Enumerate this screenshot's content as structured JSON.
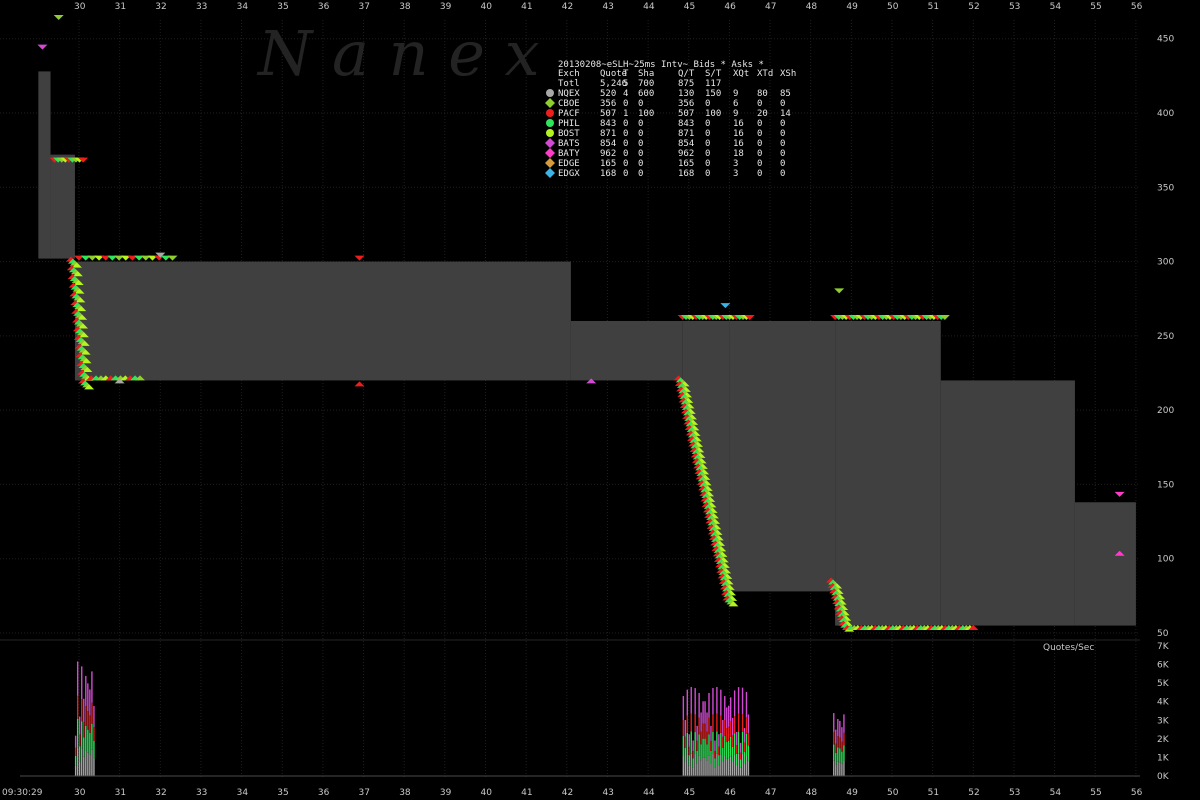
{
  "watermark": "N a n e x",
  "start_time": "09:30:29",
  "quotes_label": "Quotes/Sec",
  "colors": {
    "background": "#000000",
    "spread": "#404040",
    "NQEX": "#a8a8a8",
    "CBOE": "#8ecf2f",
    "PACF": "#ee1e1e",
    "PHIL": "#2ee65a",
    "BOST": "#b4f51e",
    "BATS": "#d24ad2",
    "BATY": "#ff3cc8",
    "EDGE": "#d79b3c",
    "EDGX": "#3cb4e6"
  },
  "table": {
    "title": "20130208~eSLH~25ms Intv~ Bids * Asks *",
    "headers": [
      "Exch",
      "Quote",
      "T",
      "Sha",
      "Q/T",
      "S/T",
      "XQt",
      "XTd",
      "XSh"
    ],
    "total": [
      "Totl",
      "5,246",
      "5",
      "700",
      "875",
      "117",
      "",
      "",
      ""
    ],
    "rows": [
      {
        "exch": "NQEX",
        "marker": "circle",
        "vals": [
          "520",
          "4",
          "600",
          "130",
          "150",
          "9",
          "80",
          "85"
        ]
      },
      {
        "exch": "CBOE",
        "marker": "diamond",
        "vals": [
          "356",
          "0",
          "0",
          "356",
          "0",
          "6",
          "0",
          "0"
        ]
      },
      {
        "exch": "PACF",
        "marker": "circle",
        "vals": [
          "507",
          "1",
          "100",
          "507",
          "100",
          "9",
          "20",
          "14"
        ]
      },
      {
        "exch": "PHIL",
        "marker": "circle",
        "vals": [
          "843",
          "0",
          "0",
          "843",
          "0",
          "16",
          "0",
          "0"
        ]
      },
      {
        "exch": "BOST",
        "marker": "circle",
        "vals": [
          "871",
          "0",
          "0",
          "871",
          "0",
          "16",
          "0",
          "0"
        ]
      },
      {
        "exch": "BATS",
        "marker": "diamond",
        "vals": [
          "854",
          "0",
          "0",
          "854",
          "0",
          "16",
          "0",
          "0"
        ]
      },
      {
        "exch": "BATY",
        "marker": "diamond",
        "vals": [
          "962",
          "0",
          "0",
          "962",
          "0",
          "18",
          "0",
          "0"
        ]
      },
      {
        "exch": "EDGE",
        "marker": "diamond",
        "vals": [
          "165",
          "0",
          "0",
          "165",
          "0",
          "3",
          "0",
          "0"
        ]
      },
      {
        "exch": "EDGX",
        "marker": "diamond",
        "vals": [
          "168",
          "0",
          "0",
          "168",
          "0",
          "3",
          "0",
          "0"
        ]
      }
    ]
  },
  "chart_data": [
    {
      "type": "area",
      "title": "",
      "xlabel": "",
      "ylabel": "",
      "x_unit": "seconds after 09:30",
      "xlim": [
        28.8,
        56.5
      ],
      "ylim": [
        50,
        460
      ],
      "x_ticks": [
        "30",
        "31",
        "32",
        "33",
        "34",
        "35",
        "36",
        "37",
        "38",
        "39",
        "40",
        "41",
        "42",
        "43",
        "44",
        "45",
        "46",
        "47",
        "48",
        "49",
        "50",
        "51",
        "52",
        "53",
        "54",
        "55",
        "56"
      ],
      "y_ticks": [
        50,
        100,
        150,
        200,
        250,
        300,
        350,
        400,
        450
      ],
      "grid": true,
      "spread_bands": [
        {
          "x": [
            29.0,
            29.3
          ],
          "low": 302,
          "high": 428
        },
        {
          "x": [
            29.3,
            29.9
          ],
          "low": 302,
          "high": 372
        },
        {
          "x": [
            29.9,
            42.1
          ],
          "low": 220,
          "high": 300
        },
        {
          "x": [
            42.1,
            44.85
          ],
          "low": 220,
          "high": 260
        },
        {
          "x": [
            44.85,
            46.0
          ],
          "points": [
            [
              44.85,
              220
            ],
            [
              45.2,
              180
            ],
            [
              45.6,
              120
            ],
            [
              46.0,
              78
            ]
          ],
          "high": 260
        },
        {
          "x": [
            46.0,
            48.6
          ],
          "low": 78,
          "high": 260
        },
        {
          "x": [
            48.6,
            51.2
          ],
          "low": 55,
          "high": 260
        },
        {
          "x": [
            51.2,
            54.5
          ],
          "low": 55,
          "high": 220
        },
        {
          "x": [
            54.5,
            56.0
          ],
          "low": 55,
          "high": 138
        }
      ],
      "quote_points": [
        {
          "exch": "NQEX",
          "side": "ask",
          "x": 32.0,
          "y": 306
        },
        {
          "exch": "NQEX",
          "side": "bid",
          "x": 31.0,
          "y": 218
        },
        {
          "exch": "PACF",
          "side": "ask",
          "x": 36.9,
          "y": 304
        },
        {
          "exch": "PACF",
          "side": "bid",
          "x": 36.9,
          "y": 216
        },
        {
          "exch": "BATS",
          "side": "ask",
          "x": 29.1,
          "y": 446
        },
        {
          "exch": "CBOE",
          "side": "ask",
          "x": 29.5,
          "y": 466
        },
        {
          "exch": "EDGX",
          "side": "ask",
          "x": 45.9,
          "y": 272
        },
        {
          "exch": "BATS",
          "side": "bid",
          "x": 42.6,
          "y": 218
        },
        {
          "exch": "CBOE",
          "side": "ask",
          "x": 48.7,
          "y": 282
        },
        {
          "exch": "BATY",
          "side": "ask",
          "x": 55.6,
          "y": 145
        },
        {
          "exch": "BATY",
          "side": "bid",
          "x": 55.6,
          "y": 102
        }
      ]
    },
    {
      "type": "bar",
      "title": "Quotes/Sec",
      "ylim": [
        0,
        7000
      ],
      "y_ticks": [
        "0K",
        "1K",
        "2K",
        "3K",
        "4K",
        "5K",
        "6K",
        "7K"
      ],
      "bursts": [
        {
          "x": [
            29.9,
            30.4
          ],
          "peak": 6200
        },
        {
          "x": [
            44.85,
            46.5
          ],
          "peak": 4800
        },
        {
          "x": [
            48.55,
            48.85
          ],
          "peak": 3600
        }
      ]
    }
  ]
}
